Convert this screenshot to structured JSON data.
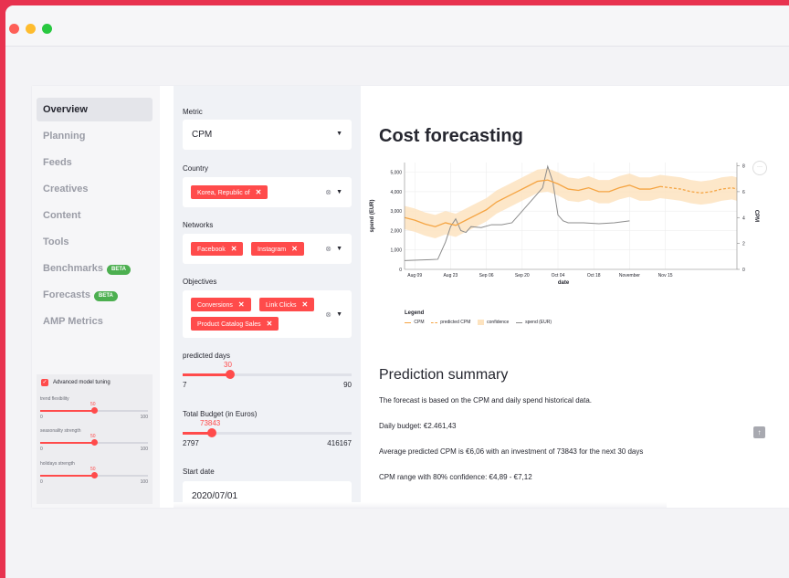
{
  "colors": {
    "accent": "#ff4b4b",
    "frame": "#e8324f",
    "beta": "#4caf50",
    "cpm": "#f5a442",
    "confidence": "#fde3bf",
    "spend": "#8c8c8c"
  },
  "window": {
    "controls": [
      "close",
      "minimize",
      "maximize"
    ]
  },
  "nav": {
    "items": [
      {
        "label": "Overview",
        "active": true
      },
      {
        "label": "Planning"
      },
      {
        "label": "Feeds"
      },
      {
        "label": "Creatives"
      },
      {
        "label": "Content"
      },
      {
        "label": "Tools"
      },
      {
        "label": "Benchmarks",
        "badge": "BETA"
      },
      {
        "label": "Forecasts",
        "badge": "BETA"
      },
      {
        "label": "AMP Metrics"
      }
    ]
  },
  "tuning": {
    "checkbox_label": "Advanced model tuning",
    "checked": true,
    "sliders": [
      {
        "label": "trend flexibility",
        "value": "50",
        "min": "0",
        "max": "100",
        "fraction": 0.5
      },
      {
        "label": "seasonality strength",
        "value": "50",
        "min": "0",
        "max": "100",
        "fraction": 0.5
      },
      {
        "label": "holidays strength",
        "value": "50",
        "min": "0",
        "max": "100",
        "fraction": 0.5
      }
    ]
  },
  "controls": {
    "metric": {
      "label": "Metric",
      "value": "CPM"
    },
    "country": {
      "label": "Country",
      "tags": [
        "Korea, Republic of"
      ]
    },
    "networks": {
      "label": "Networks",
      "tags": [
        "Facebook",
        "Instagram"
      ]
    },
    "objectives": {
      "label": "Objectives",
      "tags": [
        "Conversions",
        "Link Clicks",
        "Product Catalog Sales"
      ]
    },
    "predicted_days": {
      "label": "predicted days",
      "value": "30",
      "min": "7",
      "max": "90",
      "fraction": 0.28
    },
    "total_budget": {
      "label": "Total Budget (in Euros)",
      "value": "73843",
      "min": "2797",
      "max": "416167",
      "fraction": 0.17
    },
    "start_date": {
      "label": "Start date",
      "value": "2020/07/01"
    }
  },
  "main": {
    "title": "Cost forecasting",
    "summary_title": "Prediction summary",
    "paragraphs": [
      "The forecast is based on the CPM and daily spend historical data.",
      "Daily budget: €2.461,43",
      "Average predicted CPM is €6,06 with an investment of 73843 for the next 30 days",
      "CPM range with 80% confidence: €4,89 - €7,12"
    ]
  },
  "chart_data": {
    "type": "line",
    "xlabel": "date",
    "ylabel": "spend (EUR)",
    "y2label": "CPM",
    "x_ticks": [
      "Aug 09",
      "Aug 23",
      "Sep 06",
      "Sep 20",
      "Oct 04",
      "Oct 18",
      "November",
      "Nov 15"
    ],
    "y_ticks": [
      "0",
      "1,000",
      "2,000",
      "3,000",
      "4,000",
      "5,000"
    ],
    "y2_ticks": [
      "0",
      "2",
      "4",
      "6",
      "8"
    ],
    "ylim": [
      0,
      5500
    ],
    "y2lim": [
      0,
      8.25
    ],
    "x_range_days": [
      0,
      130
    ],
    "legend_title": "Legend",
    "legend": [
      "CPM",
      "predicted CPM",
      "confidence",
      "spend (EUR)"
    ],
    "cpm": {
      "x": [
        0,
        4,
        8,
        12,
        16,
        20,
        24,
        28,
        32,
        36,
        40,
        44,
        48,
        52,
        56,
        60,
        64,
        68,
        72,
        76,
        80,
        84,
        88,
        92,
        96,
        100
      ],
      "y": [
        4.0,
        3.8,
        3.5,
        3.3,
        3.6,
        3.4,
        3.8,
        4.2,
        4.6,
        5.2,
        5.6,
        6.0,
        6.4,
        6.8,
        6.9,
        6.6,
        6.2,
        6.1,
        6.3,
        6.0,
        6.0,
        6.3,
        6.5,
        6.2,
        6.2,
        6.4
      ]
    },
    "cpm_upper": {
      "x": [
        0,
        4,
        8,
        12,
        16,
        20,
        24,
        28,
        32,
        36,
        40,
        44,
        48,
        52,
        56,
        60,
        64,
        68,
        72,
        76,
        80,
        84,
        88,
        92,
        96,
        100,
        104,
        108,
        112,
        116,
        120,
        124,
        128,
        130
      ],
      "y": [
        4.9,
        4.7,
        4.4,
        4.2,
        4.5,
        4.3,
        4.7,
        5.1,
        5.5,
        6.1,
        6.5,
        6.9,
        7.3,
        7.7,
        7.8,
        7.5,
        7.1,
        7.0,
        7.2,
        6.9,
        6.9,
        7.2,
        7.4,
        7.1,
        7.1,
        7.3,
        7.2,
        7.1,
        6.9,
        6.8,
        6.9,
        7.1,
        7.2,
        7.1
      ]
    },
    "cpm_lower": {
      "x": [
        0,
        4,
        8,
        12,
        16,
        20,
        24,
        28,
        32,
        36,
        40,
        44,
        48,
        52,
        56,
        60,
        64,
        68,
        72,
        76,
        80,
        84,
        88,
        92,
        96,
        100,
        104,
        108,
        112,
        116,
        120,
        124,
        128,
        130
      ],
      "y": [
        3.1,
        2.9,
        2.6,
        2.4,
        2.7,
        2.5,
        2.9,
        3.3,
        3.7,
        4.3,
        4.7,
        5.1,
        5.5,
        5.9,
        6.0,
        5.7,
        5.3,
        5.2,
        5.4,
        5.1,
        5.1,
        5.4,
        5.6,
        5.3,
        5.3,
        5.5,
        5.4,
        5.3,
        5.1,
        5.0,
        5.1,
        5.3,
        5.4,
        5.3
      ]
    },
    "predicted_cpm": {
      "x": [
        100,
        104,
        108,
        112,
        116,
        120,
        124,
        128,
        130
      ],
      "y": [
        6.4,
        6.3,
        6.2,
        6.0,
        5.9,
        6.0,
        6.2,
        6.3,
        6.2
      ]
    },
    "spend": {
      "x": [
        0,
        6,
        10,
        13,
        16,
        18,
        20,
        22,
        24,
        26,
        30,
        34,
        38,
        42,
        46,
        50,
        54,
        56,
        58,
        60,
        62,
        64,
        70,
        76,
        82,
        88
      ],
      "y": [
        450,
        480,
        500,
        520,
        1400,
        2200,
        2600,
        2000,
        1900,
        2200,
        2150,
        2300,
        2300,
        2400,
        3000,
        3600,
        4200,
        5300,
        4500,
        2800,
        2500,
        2400,
        2400,
        2350,
        2400,
        2500
      ]
    }
  }
}
